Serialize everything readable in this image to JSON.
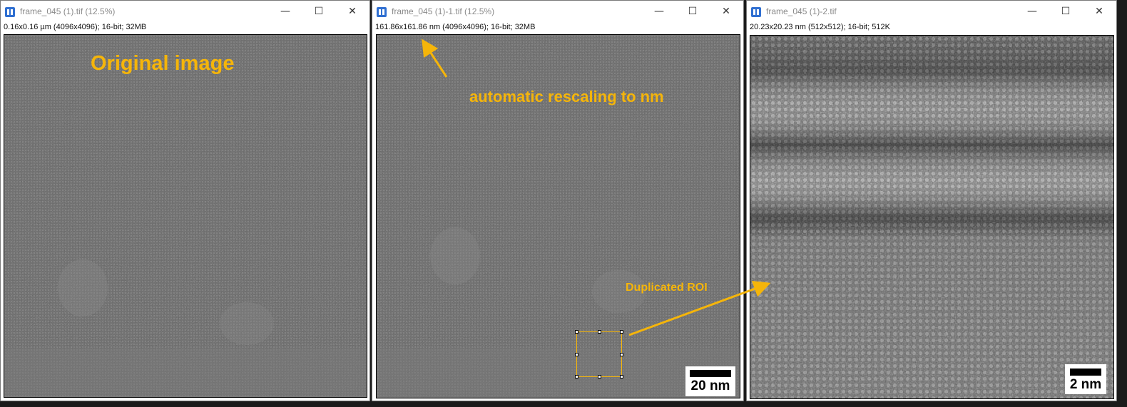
{
  "windows": [
    {
      "title": "frame_045 (1).tif (12.5%)",
      "info": "0.16x0.16 µm (4096x4096); 16-bit; 32MB",
      "overlay": "Original image"
    },
    {
      "title": "frame_045 (1)-1.tif (12.5%)",
      "info": "161.86x161.86 nm (4096x4096); 16-bit; 32MB",
      "overlay": "automatic rescaling to nm",
      "roi_label": "Duplicated ROI",
      "scalebar": "20 nm"
    },
    {
      "title": "frame_045 (1)-2.tif",
      "info": "20.23x20.23 nm (512x512); 16-bit; 512K",
      "scalebar": "2 nm"
    }
  ],
  "controls": {
    "minimize": "—",
    "maximize": "☐",
    "close": "✕"
  },
  "icons": [
    "imagej-app-icon",
    "minimize-icon",
    "maximize-icon",
    "close-icon"
  ],
  "colors": {
    "annotation": "#f5b50a",
    "background": "#1b1b1b",
    "window": "#ffffff"
  }
}
